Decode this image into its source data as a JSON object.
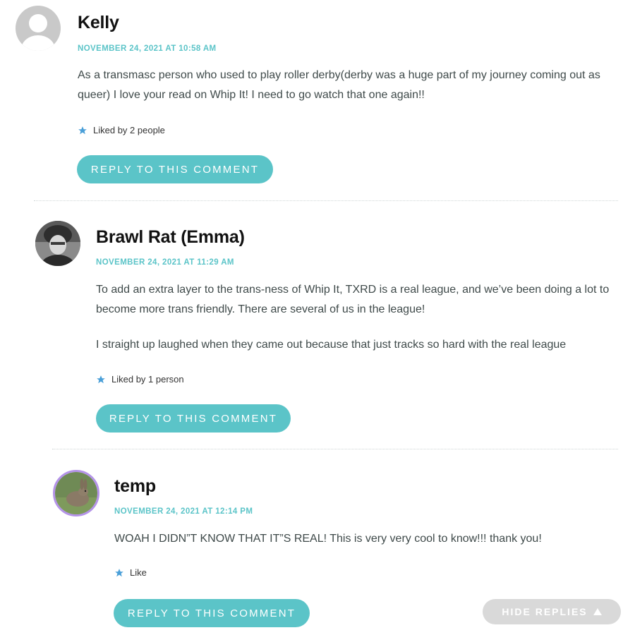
{
  "comments": [
    {
      "author": "Kelly",
      "date": "NOVEMBER 24, 2021 AT 10:58 AM",
      "paragraphs": [
        "As a transmasc person who used to play roller derby(derby was a huge part of my journey coming out as queer) I love your read on Whip It! I need to go watch that one again!!"
      ],
      "likes": "Liked by 2 people",
      "reply_label": "REPLY TO THIS COMMENT",
      "avatar_icon": "default-avatar-icon"
    },
    {
      "author": "Brawl Rat (Emma)",
      "date": "NOVEMBER 24, 2021 AT 11:29 AM",
      "paragraphs": [
        "To add an extra layer to the trans-ness of Whip It, TXRD is a real league, and we’ve been doing a lot to become more trans friendly. There are several of us in the league!",
        "I straight up laughed when they came out because that just tracks so hard with the real league"
      ],
      "likes": "Liked by 1 person",
      "reply_label": "REPLY TO THIS COMMENT",
      "avatar_icon": "user-photo-avatar"
    },
    {
      "author": "temp",
      "date": "NOVEMBER 24, 2021 AT 12:14 PM",
      "paragraphs": [
        "WOAH I DIDN”T KNOW THAT IT”S REAL! This is very very cool to know!!! thank you!"
      ],
      "likes": "Like",
      "reply_label": "REPLY TO THIS COMMENT",
      "avatar_icon": "rabbit-photo-avatar"
    }
  ],
  "hide_replies_label": "HIDE REPLIES",
  "colors": {
    "accent": "#5bc4c8",
    "star": "#4a9fd8",
    "text": "#3f4a4a",
    "hide_button": "#d9d9d9"
  }
}
